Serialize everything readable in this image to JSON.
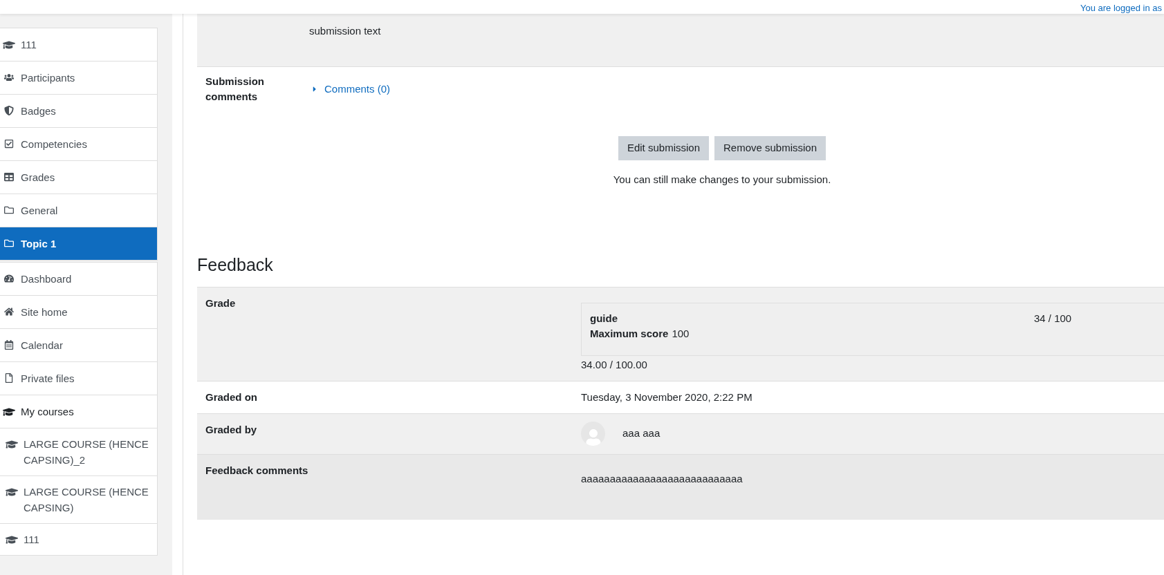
{
  "header": {
    "login_text": "You are logged in as"
  },
  "sidebar": {
    "sections": [
      {
        "items": [
          {
            "label": "111",
            "kind": "course",
            "selected": false
          },
          {
            "label": "Participants",
            "kind": "participants",
            "selected": false
          },
          {
            "label": "Badges",
            "kind": "badges",
            "selected": false
          },
          {
            "label": "Competencies",
            "kind": "competencies",
            "selected": false
          },
          {
            "label": "Grades",
            "kind": "grades",
            "selected": false
          },
          {
            "label": "General",
            "kind": "section",
            "selected": false
          },
          {
            "label": "Topic 1",
            "kind": "section",
            "selected": true
          }
        ]
      },
      {
        "items": [
          {
            "label": "Dashboard",
            "kind": "dashboard",
            "selected": false
          },
          {
            "label": "Site home",
            "kind": "home",
            "selected": false
          },
          {
            "label": "Calendar",
            "kind": "calendar",
            "selected": false
          },
          {
            "label": "Private files",
            "kind": "files",
            "selected": false
          },
          {
            "label": "My courses",
            "kind": "course",
            "selected": false,
            "children": [
              {
                "label": "LARGE COURSE (HENCE CAPSING)_2",
                "kind": "course",
                "selected": false
              },
              {
                "label": "LARGE COURSE (HENCE CAPSING)",
                "kind": "course",
                "selected": false
              },
              {
                "label": "111",
                "kind": "course",
                "selected": false
              }
            ]
          }
        ]
      }
    ]
  },
  "submission": {
    "text": "submission text",
    "comments_label": "Submission comments",
    "comments_link": "Comments (0)",
    "buttons": [
      "Edit submission",
      "Remove submission"
    ],
    "note": "You can still make changes to your submission."
  },
  "feedback": {
    "heading": "Feedback",
    "rows": [
      {
        "kind": "grade",
        "label": "Grade",
        "guide_name": "guide",
        "max_label": "Maximum score",
        "max_value": "100",
        "guide_score": "34 / 100",
        "grade": "34.00 / 100.00"
      },
      {
        "kind": "text",
        "label": "Graded on",
        "value": "Tuesday, 3 November 2020, 2:22 PM"
      },
      {
        "kind": "user",
        "label": "Graded by",
        "value": "aaa aaa"
      },
      {
        "kind": "comments",
        "label": "Feedback comments",
        "value": "aaaaaaaaaaaaaaaaaaaaaaaaaaaa"
      }
    ]
  }
}
